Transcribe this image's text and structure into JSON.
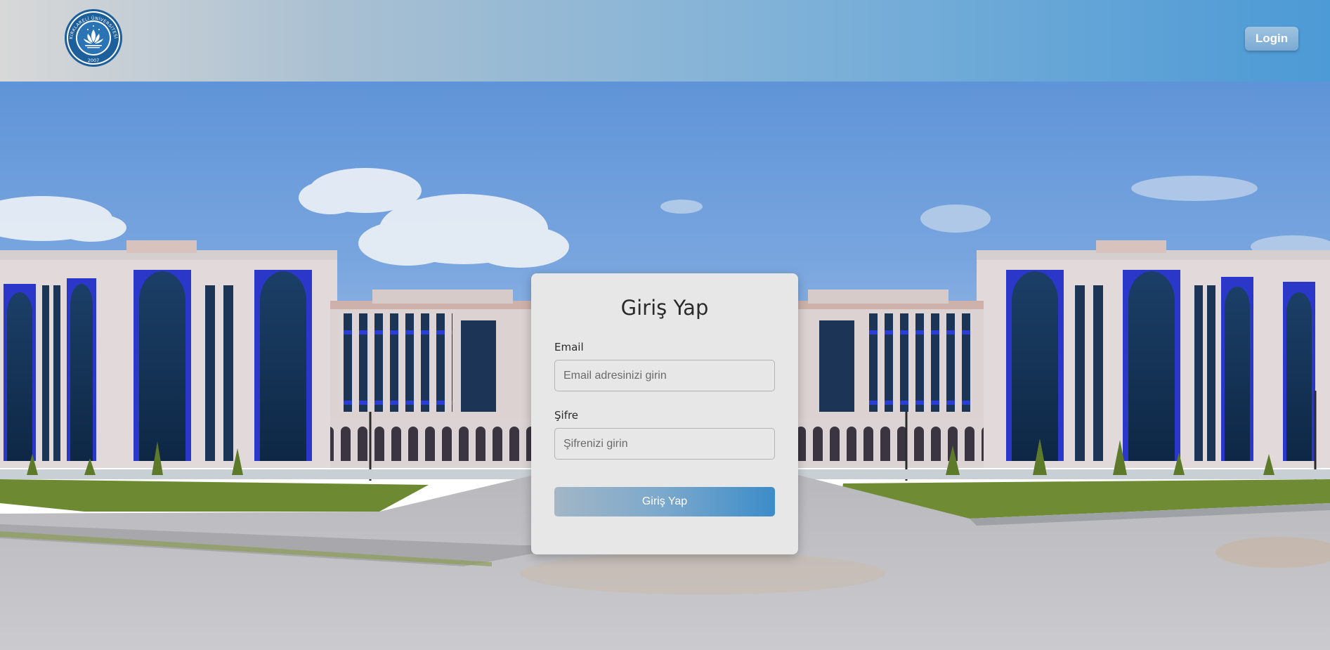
{
  "header": {
    "logo_text": "KIRKLARELİ ÜNİVERSİTESİ",
    "logo_year": "2007",
    "login_label": "Login"
  },
  "login_form": {
    "title": "Giriş Yap",
    "email_label": "Email",
    "email_placeholder": "Email adresinizi girin",
    "email_value": "",
    "password_label": "Şifre",
    "password_placeholder": "Şifrenizi girin",
    "password_value": "",
    "submit_label": "Giriş Yap"
  },
  "colors": {
    "accent": "#3c8cc9",
    "header_gradient_end": "#4c9ad6",
    "card_background": "#e7e7e7"
  }
}
